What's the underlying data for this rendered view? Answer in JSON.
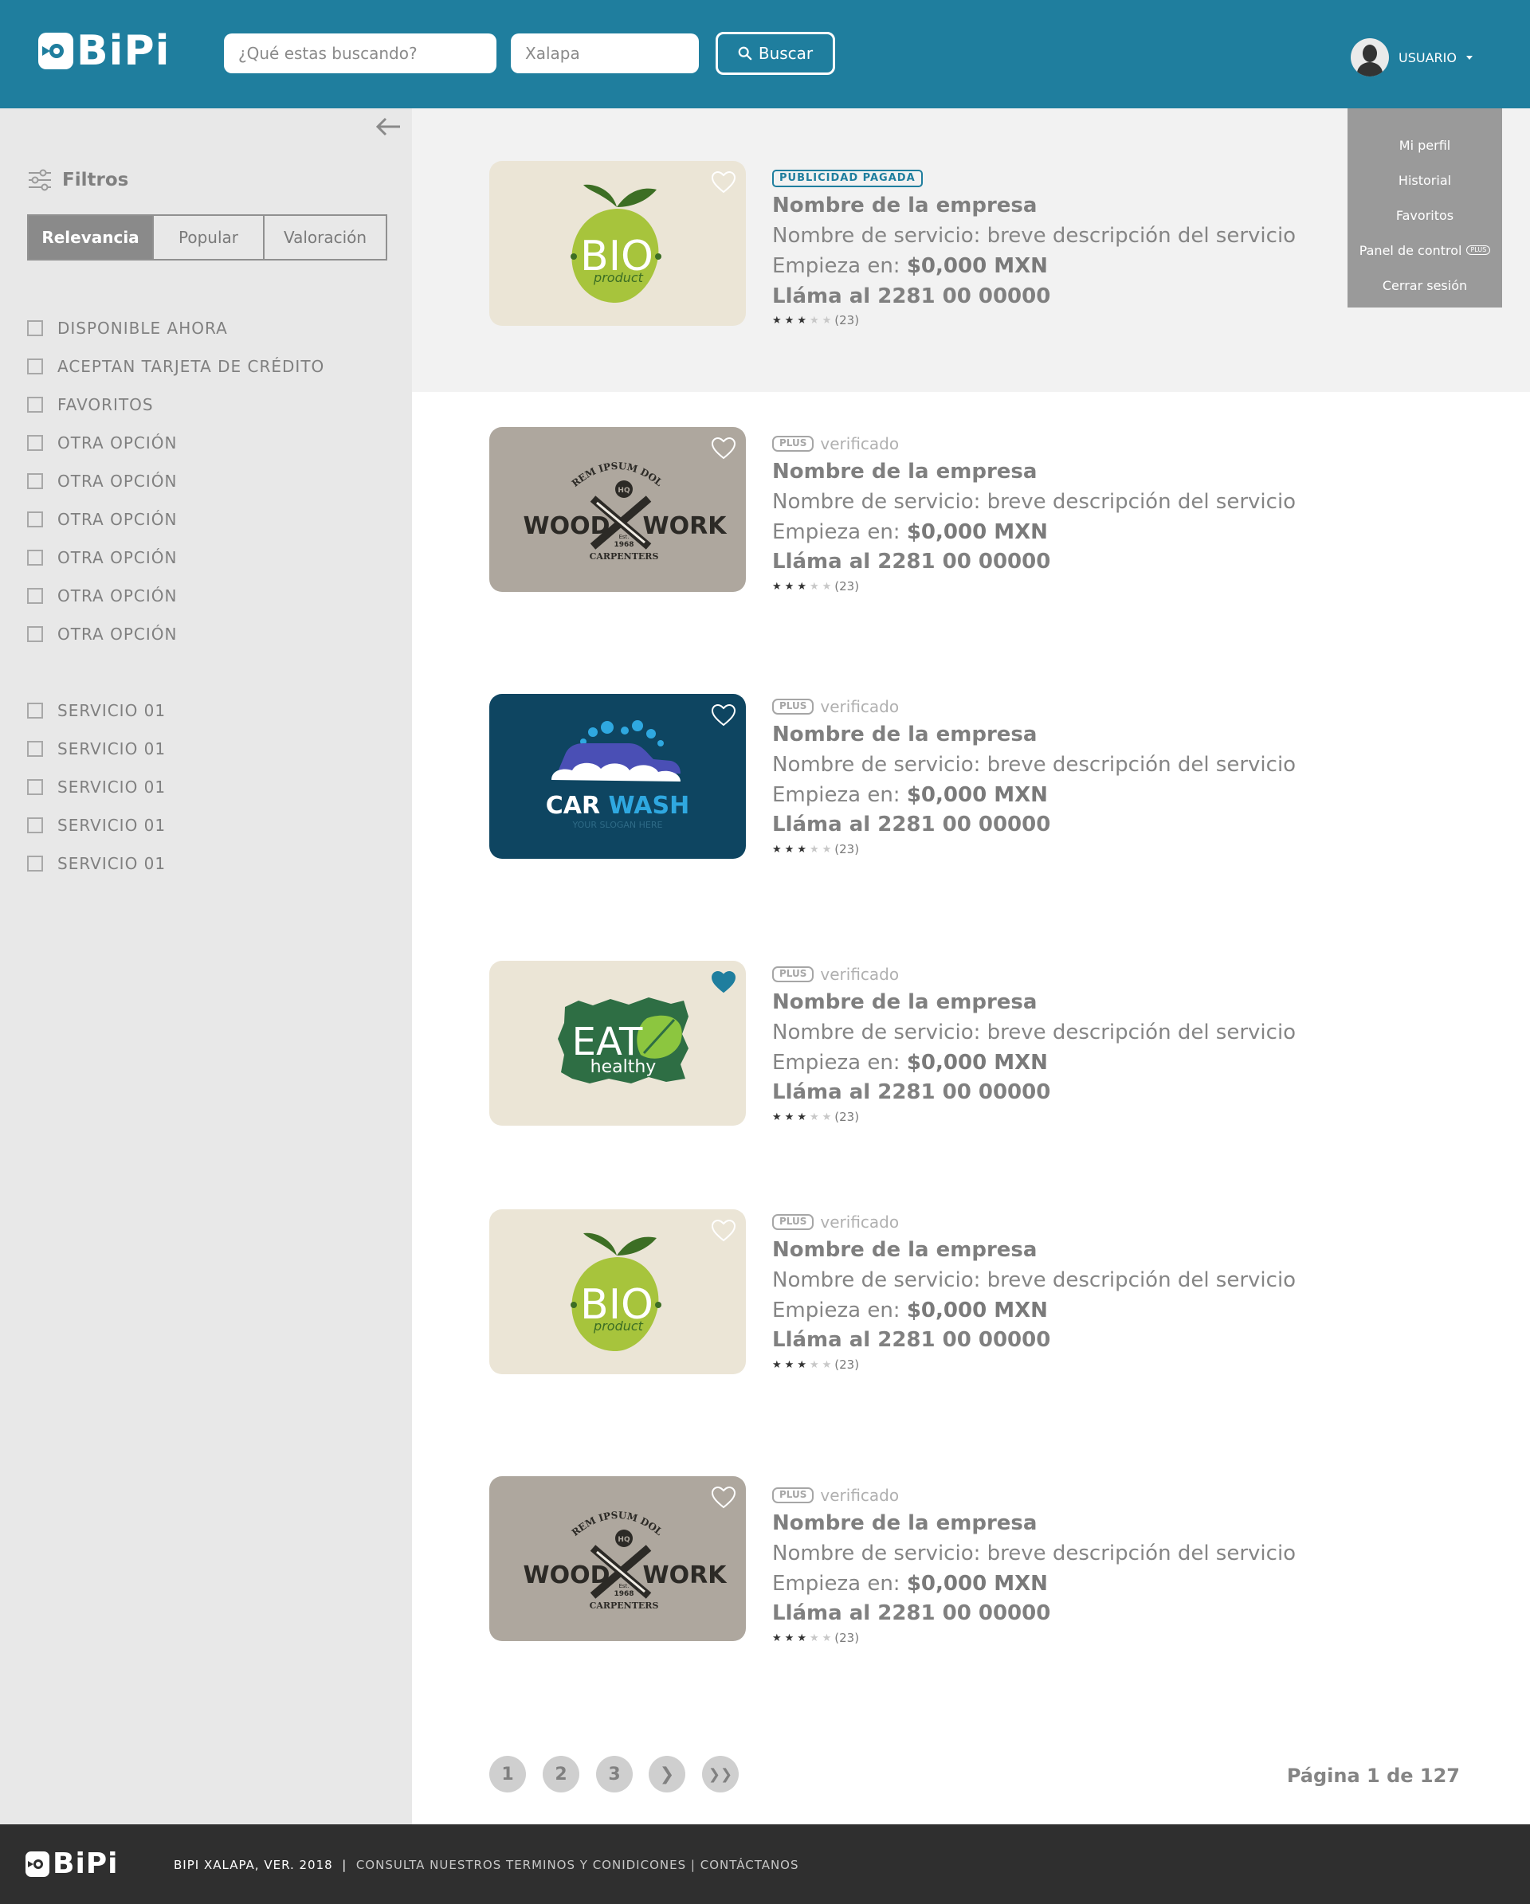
{
  "header": {
    "logo_text": "BiPi",
    "search_placeholder": "¿Qué estas buscando?",
    "location_value": "Xalapa",
    "search_button": "Buscar",
    "user_label": "USUARIO"
  },
  "user_menu": {
    "items": [
      "Mi perfil",
      "Historial",
      "Favoritos",
      "Panel de control",
      "Cerrar sesión"
    ],
    "plus_badge": "PLUS"
  },
  "sidebar": {
    "filters_title": "Filtros",
    "sort_tabs": [
      "Relevancia",
      "Popular",
      "Valoración"
    ],
    "sort_active": "Relevancia",
    "options": [
      "DISPONIBLE AHORA",
      "ACEPTAN TARJETA DE CRÉDITO",
      "FAVORITOS",
      "OTRA OPCIÓN",
      "OTRA OPCIÓN",
      "OTRA OPCIÓN",
      "OTRA OPCIÓN",
      "OTRA OPCIÓN",
      "OTRA OPCIÓN"
    ],
    "services": [
      "SERVICIO 01",
      "SERVICIO 01",
      "SERVICIO 01",
      "SERVICIO 01",
      "SERVICIO 01"
    ]
  },
  "listings": [
    {
      "badge": "PUBLICIDAD PAGADA",
      "company": "Nombre de la empresa",
      "service": "Nombre de servicio: breve descripción del servicio",
      "price_label": "Empieza en:",
      "price_value": "$0,000 MXN",
      "phone": "Lláma al 2281 00 00000",
      "stars": 3,
      "reviews": "(23)",
      "favorite": false,
      "image": "bio"
    },
    {
      "plus": "PLUS",
      "verified": "verificado",
      "company": "Nombre de la empresa",
      "service": "Nombre de servicio: breve descripción del servicio",
      "price_label": "Empieza en:",
      "price_value": "$0,000 MXN",
      "phone": "Lláma al 2281 00 00000",
      "stars": 3,
      "reviews": "(23)",
      "favorite": false,
      "image": "woodwork"
    },
    {
      "plus": "PLUS",
      "verified": "verificado",
      "company": "Nombre de la empresa",
      "service": "Nombre de servicio: breve descripción del servicio",
      "price_label": "Empieza en:",
      "price_value": "$0,000 MXN",
      "phone": "Lláma al 2281 00 00000",
      "stars": 3,
      "reviews": "(23)",
      "favorite": false,
      "image": "carwash"
    },
    {
      "plus": "PLUS",
      "verified": "verificado",
      "company": "Nombre de la empresa",
      "service": "Nombre de servicio: breve descripción del servicio",
      "price_label": "Empieza en:",
      "price_value": "$0,000 MXN",
      "phone": "Lláma al 2281 00 00000",
      "stars": 3,
      "reviews": "(23)",
      "favorite": true,
      "image": "eathealthy"
    },
    {
      "plus": "PLUS",
      "verified": "verificado",
      "company": "Nombre de la empresa",
      "service": "Nombre de servicio: breve descripción del servicio",
      "price_label": "Empieza en:",
      "price_value": "$0,000 MXN",
      "phone": "Lláma al 2281 00 00000",
      "stars": 3,
      "reviews": "(23)",
      "favorite": false,
      "image": "bio"
    },
    {
      "plus": "PLUS",
      "verified": "verificado",
      "company": "Nombre de la empresa",
      "service": "Nombre de servicio: breve descripción del servicio",
      "price_label": "Empieza en:",
      "price_value": "$0,000 MXN",
      "phone": "Lláma al 2281 00 00000",
      "stars": 3,
      "reviews": "(23)",
      "favorite": false,
      "image": "woodwork"
    }
  ],
  "images": {
    "bio_text": "BIO",
    "bio_sub": "product",
    "woodwork_left": "WOOD",
    "woodwork_right": "WORK",
    "woodwork_arc": "LOREM IPSUM DOLOR",
    "woodwork_bottom": "CARPENTERS",
    "woodwork_hq": "HQ",
    "woodwork_est": "Est.",
    "woodwork_year": "1968",
    "carwash_title_a": "CAR",
    "carwash_title_b": "WASH",
    "carwash_slogan": "YOUR SLOGAN HERE",
    "eat_a": "EAT",
    "eat_b": "healthy"
  },
  "pagination": {
    "pages": [
      "1",
      "2",
      "3"
    ],
    "next": "❯",
    "last": "❯❯",
    "info": "Página 1 de 127"
  },
  "footer": {
    "logo_text": "BiPi",
    "version": "BIPI XALAPA, VER.  2018",
    "sep1": "|",
    "terms": "CONSULTA NUESTROS TERMINOS Y CONIDICONES",
    "sep2": "|",
    "contact": "CONTÁCTANOS"
  },
  "colors": {
    "brand": "#1f7e9e",
    "sidebar_bg": "#e8e8e8",
    "footer_bg": "#2f2f2f"
  }
}
